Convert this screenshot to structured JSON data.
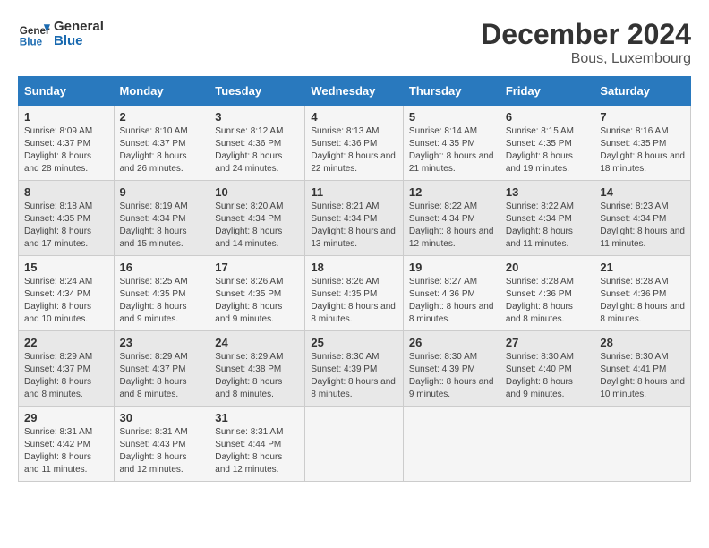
{
  "header": {
    "logo_line1": "General",
    "logo_line2": "Blue",
    "month_title": "December 2024",
    "location": "Bous, Luxembourg"
  },
  "days_of_week": [
    "Sunday",
    "Monday",
    "Tuesday",
    "Wednesday",
    "Thursday",
    "Friday",
    "Saturday"
  ],
  "weeks": [
    [
      {
        "day": "1",
        "sunrise": "Sunrise: 8:09 AM",
        "sunset": "Sunset: 4:37 PM",
        "daylight": "Daylight: 8 hours and 28 minutes."
      },
      {
        "day": "2",
        "sunrise": "Sunrise: 8:10 AM",
        "sunset": "Sunset: 4:37 PM",
        "daylight": "Daylight: 8 hours and 26 minutes."
      },
      {
        "day": "3",
        "sunrise": "Sunrise: 8:12 AM",
        "sunset": "Sunset: 4:36 PM",
        "daylight": "Daylight: 8 hours and 24 minutes."
      },
      {
        "day": "4",
        "sunrise": "Sunrise: 8:13 AM",
        "sunset": "Sunset: 4:36 PM",
        "daylight": "Daylight: 8 hours and 22 minutes."
      },
      {
        "day": "5",
        "sunrise": "Sunrise: 8:14 AM",
        "sunset": "Sunset: 4:35 PM",
        "daylight": "Daylight: 8 hours and 21 minutes."
      },
      {
        "day": "6",
        "sunrise": "Sunrise: 8:15 AM",
        "sunset": "Sunset: 4:35 PM",
        "daylight": "Daylight: 8 hours and 19 minutes."
      },
      {
        "day": "7",
        "sunrise": "Sunrise: 8:16 AM",
        "sunset": "Sunset: 4:35 PM",
        "daylight": "Daylight: 8 hours and 18 minutes."
      }
    ],
    [
      {
        "day": "8",
        "sunrise": "Sunrise: 8:18 AM",
        "sunset": "Sunset: 4:35 PM",
        "daylight": "Daylight: 8 hours and 17 minutes."
      },
      {
        "day": "9",
        "sunrise": "Sunrise: 8:19 AM",
        "sunset": "Sunset: 4:34 PM",
        "daylight": "Daylight: 8 hours and 15 minutes."
      },
      {
        "day": "10",
        "sunrise": "Sunrise: 8:20 AM",
        "sunset": "Sunset: 4:34 PM",
        "daylight": "Daylight: 8 hours and 14 minutes."
      },
      {
        "day": "11",
        "sunrise": "Sunrise: 8:21 AM",
        "sunset": "Sunset: 4:34 PM",
        "daylight": "Daylight: 8 hours and 13 minutes."
      },
      {
        "day": "12",
        "sunrise": "Sunrise: 8:22 AM",
        "sunset": "Sunset: 4:34 PM",
        "daylight": "Daylight: 8 hours and 12 minutes."
      },
      {
        "day": "13",
        "sunrise": "Sunrise: 8:22 AM",
        "sunset": "Sunset: 4:34 PM",
        "daylight": "Daylight: 8 hours and 11 minutes."
      },
      {
        "day": "14",
        "sunrise": "Sunrise: 8:23 AM",
        "sunset": "Sunset: 4:34 PM",
        "daylight": "Daylight: 8 hours and 11 minutes."
      }
    ],
    [
      {
        "day": "15",
        "sunrise": "Sunrise: 8:24 AM",
        "sunset": "Sunset: 4:34 PM",
        "daylight": "Daylight: 8 hours and 10 minutes."
      },
      {
        "day": "16",
        "sunrise": "Sunrise: 8:25 AM",
        "sunset": "Sunset: 4:35 PM",
        "daylight": "Daylight: 8 hours and 9 minutes."
      },
      {
        "day": "17",
        "sunrise": "Sunrise: 8:26 AM",
        "sunset": "Sunset: 4:35 PM",
        "daylight": "Daylight: 8 hours and 9 minutes."
      },
      {
        "day": "18",
        "sunrise": "Sunrise: 8:26 AM",
        "sunset": "Sunset: 4:35 PM",
        "daylight": "Daylight: 8 hours and 8 minutes."
      },
      {
        "day": "19",
        "sunrise": "Sunrise: 8:27 AM",
        "sunset": "Sunset: 4:36 PM",
        "daylight": "Daylight: 8 hours and 8 minutes."
      },
      {
        "day": "20",
        "sunrise": "Sunrise: 8:28 AM",
        "sunset": "Sunset: 4:36 PM",
        "daylight": "Daylight: 8 hours and 8 minutes."
      },
      {
        "day": "21",
        "sunrise": "Sunrise: 8:28 AM",
        "sunset": "Sunset: 4:36 PM",
        "daylight": "Daylight: 8 hours and 8 minutes."
      }
    ],
    [
      {
        "day": "22",
        "sunrise": "Sunrise: 8:29 AM",
        "sunset": "Sunset: 4:37 PM",
        "daylight": "Daylight: 8 hours and 8 minutes."
      },
      {
        "day": "23",
        "sunrise": "Sunrise: 8:29 AM",
        "sunset": "Sunset: 4:37 PM",
        "daylight": "Daylight: 8 hours and 8 minutes."
      },
      {
        "day": "24",
        "sunrise": "Sunrise: 8:29 AM",
        "sunset": "Sunset: 4:38 PM",
        "daylight": "Daylight: 8 hours and 8 minutes."
      },
      {
        "day": "25",
        "sunrise": "Sunrise: 8:30 AM",
        "sunset": "Sunset: 4:39 PM",
        "daylight": "Daylight: 8 hours and 8 minutes."
      },
      {
        "day": "26",
        "sunrise": "Sunrise: 8:30 AM",
        "sunset": "Sunset: 4:39 PM",
        "daylight": "Daylight: 8 hours and 9 minutes."
      },
      {
        "day": "27",
        "sunrise": "Sunrise: 8:30 AM",
        "sunset": "Sunset: 4:40 PM",
        "daylight": "Daylight: 8 hours and 9 minutes."
      },
      {
        "day": "28",
        "sunrise": "Sunrise: 8:30 AM",
        "sunset": "Sunset: 4:41 PM",
        "daylight": "Daylight: 8 hours and 10 minutes."
      }
    ],
    [
      {
        "day": "29",
        "sunrise": "Sunrise: 8:31 AM",
        "sunset": "Sunset: 4:42 PM",
        "daylight": "Daylight: 8 hours and 11 minutes."
      },
      {
        "day": "30",
        "sunrise": "Sunrise: 8:31 AM",
        "sunset": "Sunset: 4:43 PM",
        "daylight": "Daylight: 8 hours and 12 minutes."
      },
      {
        "day": "31",
        "sunrise": "Sunrise: 8:31 AM",
        "sunset": "Sunset: 4:44 PM",
        "daylight": "Daylight: 8 hours and 12 minutes."
      },
      null,
      null,
      null,
      null
    ]
  ]
}
